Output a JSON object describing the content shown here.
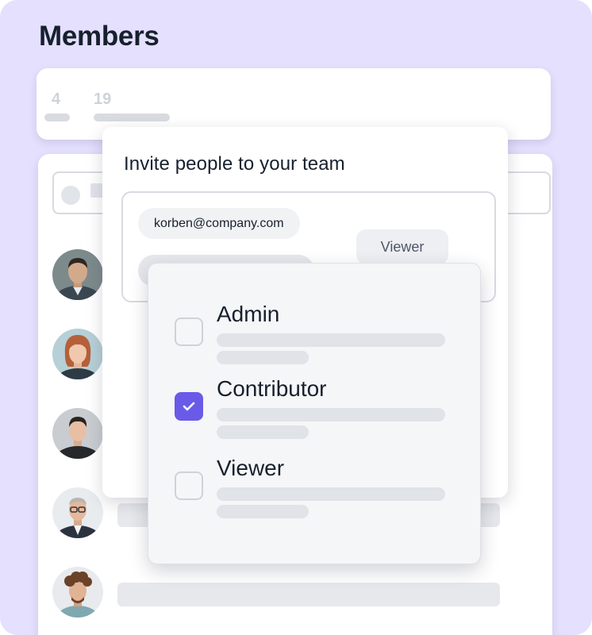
{
  "page": {
    "title": "Members"
  },
  "stats": [
    {
      "value": "4"
    },
    {
      "value": "19"
    }
  ],
  "members": [
    {
      "avatar": "avatar-man-suit"
    },
    {
      "avatar": "avatar-woman-redhair"
    },
    {
      "avatar": "avatar-man-dark"
    },
    {
      "avatar": "avatar-man-glasses"
    },
    {
      "avatar": "avatar-man-curly"
    }
  ],
  "invite": {
    "title": "Invite people to your team",
    "email": "korben@company.com",
    "role_button": "Viewer"
  },
  "roles": [
    {
      "label": "Admin",
      "checked": false
    },
    {
      "label": "Contributor",
      "checked": true
    },
    {
      "label": "Viewer",
      "checked": false
    }
  ],
  "colors": {
    "background": "#e4e0fd",
    "accent": "#6a5ae8",
    "text": "#17202e",
    "placeholder": "#e6e8ec"
  },
  "icons": {
    "checkmark": "check-icon",
    "search": "search-icon"
  }
}
